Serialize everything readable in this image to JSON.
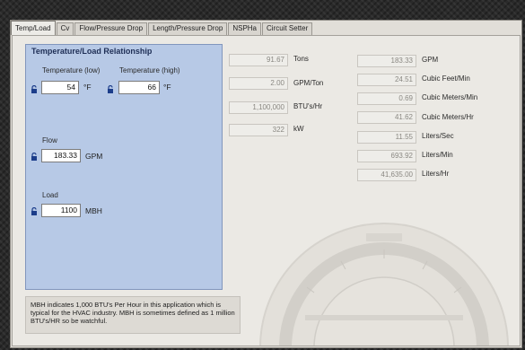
{
  "tabs": [
    {
      "label": "Temp/Load",
      "active": true
    },
    {
      "label": "Cv",
      "active": false
    },
    {
      "label": "Flow/Pressure Drop",
      "active": false
    },
    {
      "label": "Length/Pressure Drop",
      "active": false
    },
    {
      "label": "NSPHa",
      "active": false
    },
    {
      "label": "Circuit Setter",
      "active": false
    }
  ],
  "group": {
    "title": "Temperature/Load Relationship",
    "temp_low_label": "Temperature (low)",
    "temp_low_value": "54",
    "temp_low_unit": "°F",
    "temp_high_label": "Temperature (high)",
    "temp_high_value": "66",
    "temp_high_unit": "°F",
    "flow_label": "Flow",
    "flow_value": "183.33",
    "flow_unit": "GPM",
    "load_label": "Load",
    "load_value": "1100",
    "load_unit": "MBH"
  },
  "results_left": [
    {
      "value": "91.67",
      "unit": "Tons"
    },
    {
      "value": "2.00",
      "unit": "GPM/Ton"
    },
    {
      "value": "1,100,000",
      "unit": "BTU's/Hr"
    },
    {
      "value": "322",
      "unit": "kW"
    }
  ],
  "results_right": [
    {
      "value": "183.33",
      "unit": "GPM"
    },
    {
      "value": "24.51",
      "unit": "Cubic Feet/Min"
    },
    {
      "value": "0.69",
      "unit": "Cubic Meters/Min"
    },
    {
      "value": "41.62",
      "unit": "Cubic Meters/Hr"
    },
    {
      "value": "11.55",
      "unit": "Liters/Sec"
    },
    {
      "value": "693.92",
      "unit": "Liters/Min"
    },
    {
      "value": "41,635.00",
      "unit": "Liters/Hr"
    }
  ],
  "note": "MBH indicates 1,000 BTU's Per Hour in this application which is typical for the HVAC industry.   MBH is sometimes defined as 1 million BTU's/HR so be watchful.",
  "icons": {
    "lock": "lock-icon"
  },
  "colors": {
    "group_bg": "#b7c9e6",
    "panel_bg": "#ebe9e4",
    "lock": "#1c3d8a"
  }
}
